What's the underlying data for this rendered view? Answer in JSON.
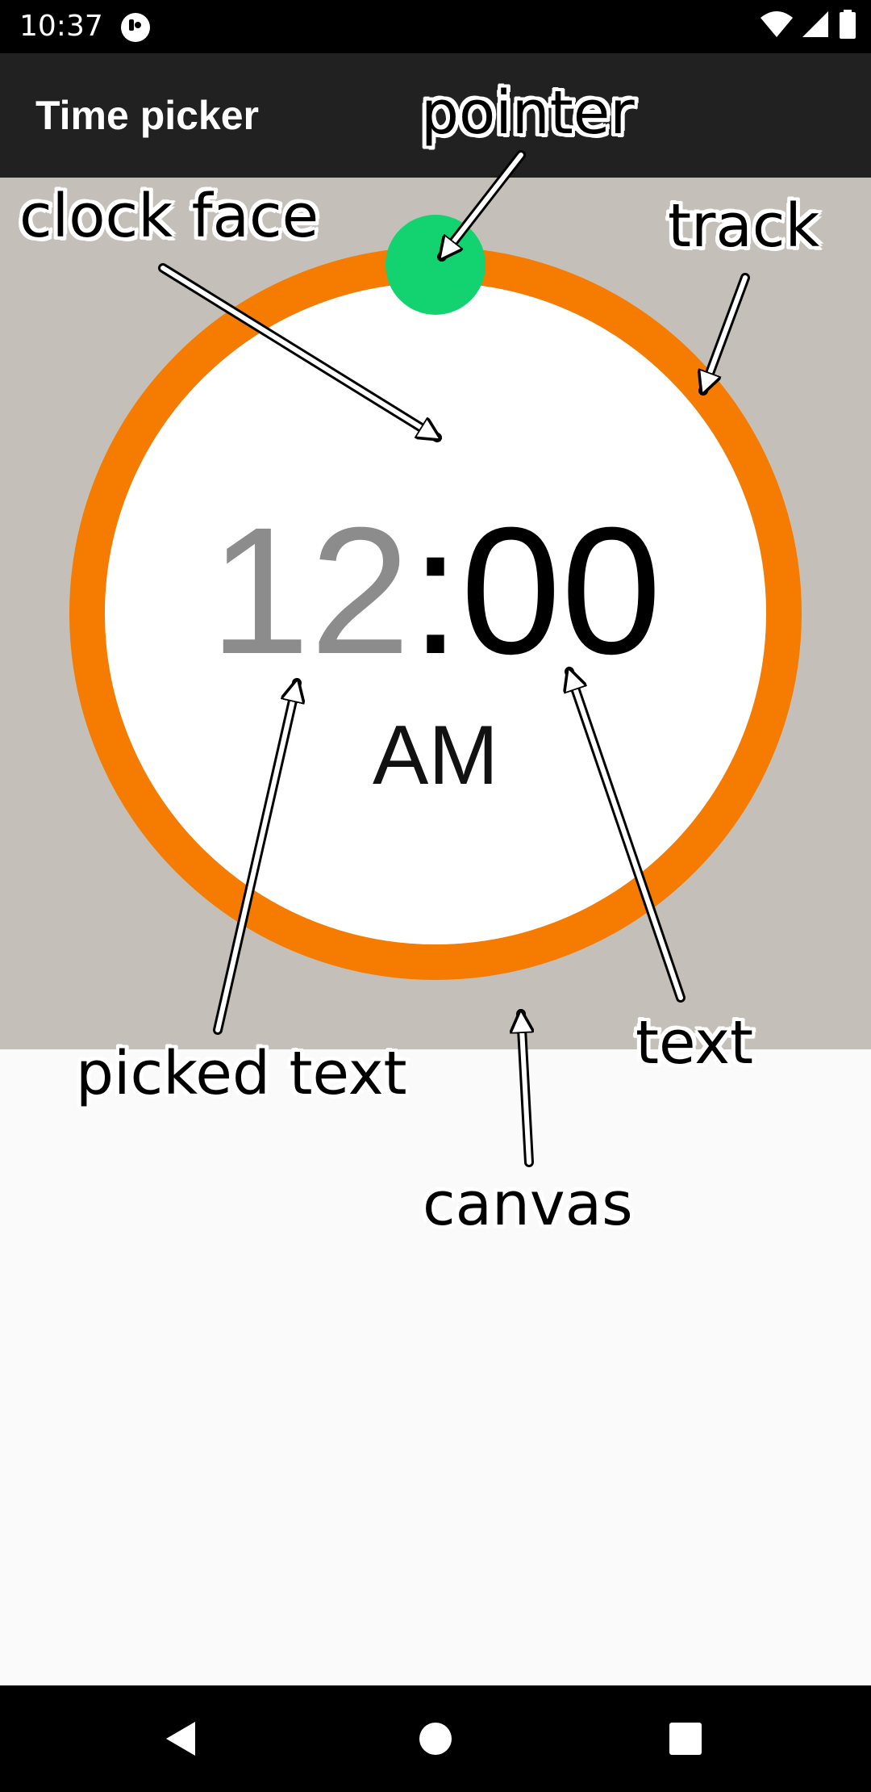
{
  "status_bar": {
    "time": "10:37",
    "icons": [
      "app-notification-icon",
      "wifi-icon",
      "signal-icon",
      "battery-icon"
    ]
  },
  "app_bar": {
    "title": "Time picker"
  },
  "clock": {
    "hours": "12",
    "separator": ":",
    "minutes": "00",
    "period": "AM",
    "colors": {
      "canvas": "#c4c0b9",
      "track": "#f57c00",
      "face": "#ffffff",
      "pointer": "#12d36f",
      "picked_text": "#8c8c8c",
      "text": "#000000"
    }
  },
  "annotations": {
    "pointer": "pointer",
    "clock_face": "clock face",
    "track": "track",
    "picked_text": "picked text",
    "text": "text",
    "canvas": "canvas"
  },
  "nav_bar": {
    "icons": [
      "back-icon",
      "home-icon",
      "recents-icon"
    ]
  }
}
